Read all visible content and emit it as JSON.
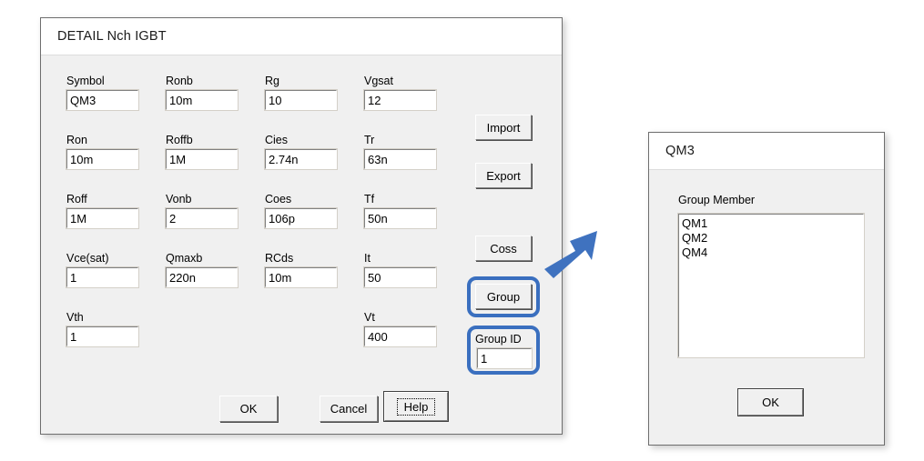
{
  "main_dialog": {
    "title": "DETAIL Nch IGBT",
    "fields": [
      {
        "label": "Symbol",
        "value": "QM3"
      },
      {
        "label": "Ronb",
        "value": "10m"
      },
      {
        "label": "Rg",
        "value": "10"
      },
      {
        "label": "Vgsat",
        "value": "12"
      },
      {
        "label": "Ron",
        "value": "10m"
      },
      {
        "label": "Roffb",
        "value": "1M"
      },
      {
        "label": "Cies",
        "value": "2.74n"
      },
      {
        "label": "Tr",
        "value": "63n"
      },
      {
        "label": "Roff",
        "value": "1M"
      },
      {
        "label": "Vonb",
        "value": "2"
      },
      {
        "label": "Coes",
        "value": "106p"
      },
      {
        "label": "Tf",
        "value": "50n"
      },
      {
        "label": "Vce(sat)",
        "value": "1"
      },
      {
        "label": "Qmaxb",
        "value": "220n"
      },
      {
        "label": "RCds",
        "value": "10m"
      },
      {
        "label": "It",
        "value": "50"
      },
      {
        "label": "Vth",
        "value": "1"
      },
      {
        "label": "Vt",
        "value": "400"
      }
    ],
    "side_buttons": {
      "import": "Import",
      "export": "Export",
      "coss": "Coss",
      "group": "Group"
    },
    "group_id": {
      "label": "Group ID",
      "value": "1"
    },
    "bottom_buttons": {
      "ok": "OK",
      "cancel": "Cancel",
      "help": "Help"
    }
  },
  "group_dialog": {
    "title": "QM3",
    "list_label": "Group Member",
    "members": [
      "QM1",
      "QM2",
      "QM4"
    ],
    "ok": "OK"
  },
  "annotation": {
    "highlight_color": "#3a6fbf",
    "arrow_color": "#3f72bf"
  }
}
